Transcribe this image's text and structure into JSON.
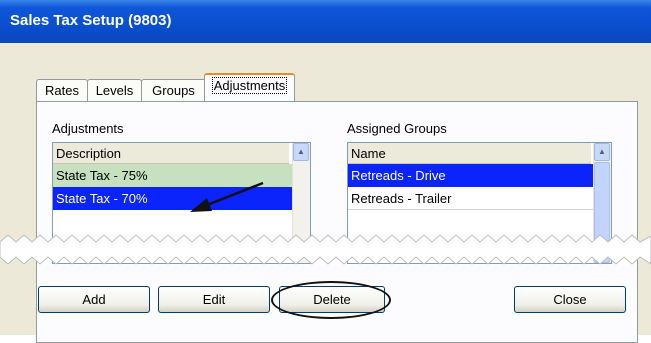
{
  "window": {
    "title": "Sales Tax Setup (9803)"
  },
  "tabs": [
    {
      "label": "Rates",
      "active": false
    },
    {
      "label": "Levels",
      "active": false
    },
    {
      "label": "Groups",
      "active": false
    },
    {
      "label": "Adjustments",
      "active": true
    }
  ],
  "adjustments": {
    "label": "Adjustments",
    "column": "Description",
    "rows": [
      "State Tax - 75%",
      "State Tax - 70%"
    ]
  },
  "assigned": {
    "label": "Assigned Groups",
    "column": "Name",
    "rows": [
      "Retreads - Drive",
      "Retreads - Trailer"
    ]
  },
  "buttons": {
    "add": "Add",
    "edit": "Edit",
    "delete": "Delete",
    "close": "Close"
  },
  "colors": {
    "title_bar": "#0a4fd0",
    "selection": "#0b24fb",
    "highlight_row": "#c6e0c0"
  }
}
